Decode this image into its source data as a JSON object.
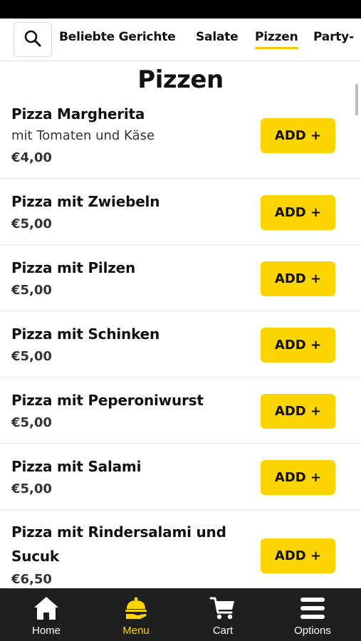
{
  "nav": {
    "search_icon": "search-icon",
    "categories": [
      {
        "label": "Beliebte Gerichte",
        "active": false
      },
      {
        "label": "Salate",
        "active": false
      },
      {
        "label": "Pizzen",
        "active": true
      },
      {
        "label": "Party-",
        "active": false
      }
    ]
  },
  "section": {
    "title": "Pizzen"
  },
  "items": [
    {
      "name": "Pizza Margherita",
      "description": "mit Tomaten und Käse",
      "price": "€4,00",
      "button": "ADD +"
    },
    {
      "name": "Pizza mit Zwiebeln",
      "price": "€5,00",
      "button": "ADD +"
    },
    {
      "name": "Pizza mit Pilzen",
      "price": "€5,00",
      "button": "ADD +"
    },
    {
      "name": "Pizza mit Schinken",
      "price": "€5,00",
      "button": "ADD +"
    },
    {
      "name": "Pizza mit Peperoniwurst",
      "price": "€5,00",
      "button": "ADD +"
    },
    {
      "name": "Pizza mit Salami",
      "price": "€5,00",
      "button": "ADD +"
    },
    {
      "name": "Pizza mit Rindersalami und Sucuk",
      "price": "€6,50",
      "button": "ADD +"
    }
  ],
  "bottom_nav": [
    {
      "label": "Home",
      "icon": "home-icon",
      "active": false
    },
    {
      "label": "Menu",
      "icon": "serving-cloche-icon",
      "active": true
    },
    {
      "label": "Cart",
      "icon": "cart-icon",
      "active": false
    },
    {
      "label": "Options",
      "icon": "menu-lines-icon",
      "active": false
    }
  ],
  "colors": {
    "accent": "#fcd400",
    "nav_bg": "#1f1f1f",
    "status_bar": "#000000"
  }
}
